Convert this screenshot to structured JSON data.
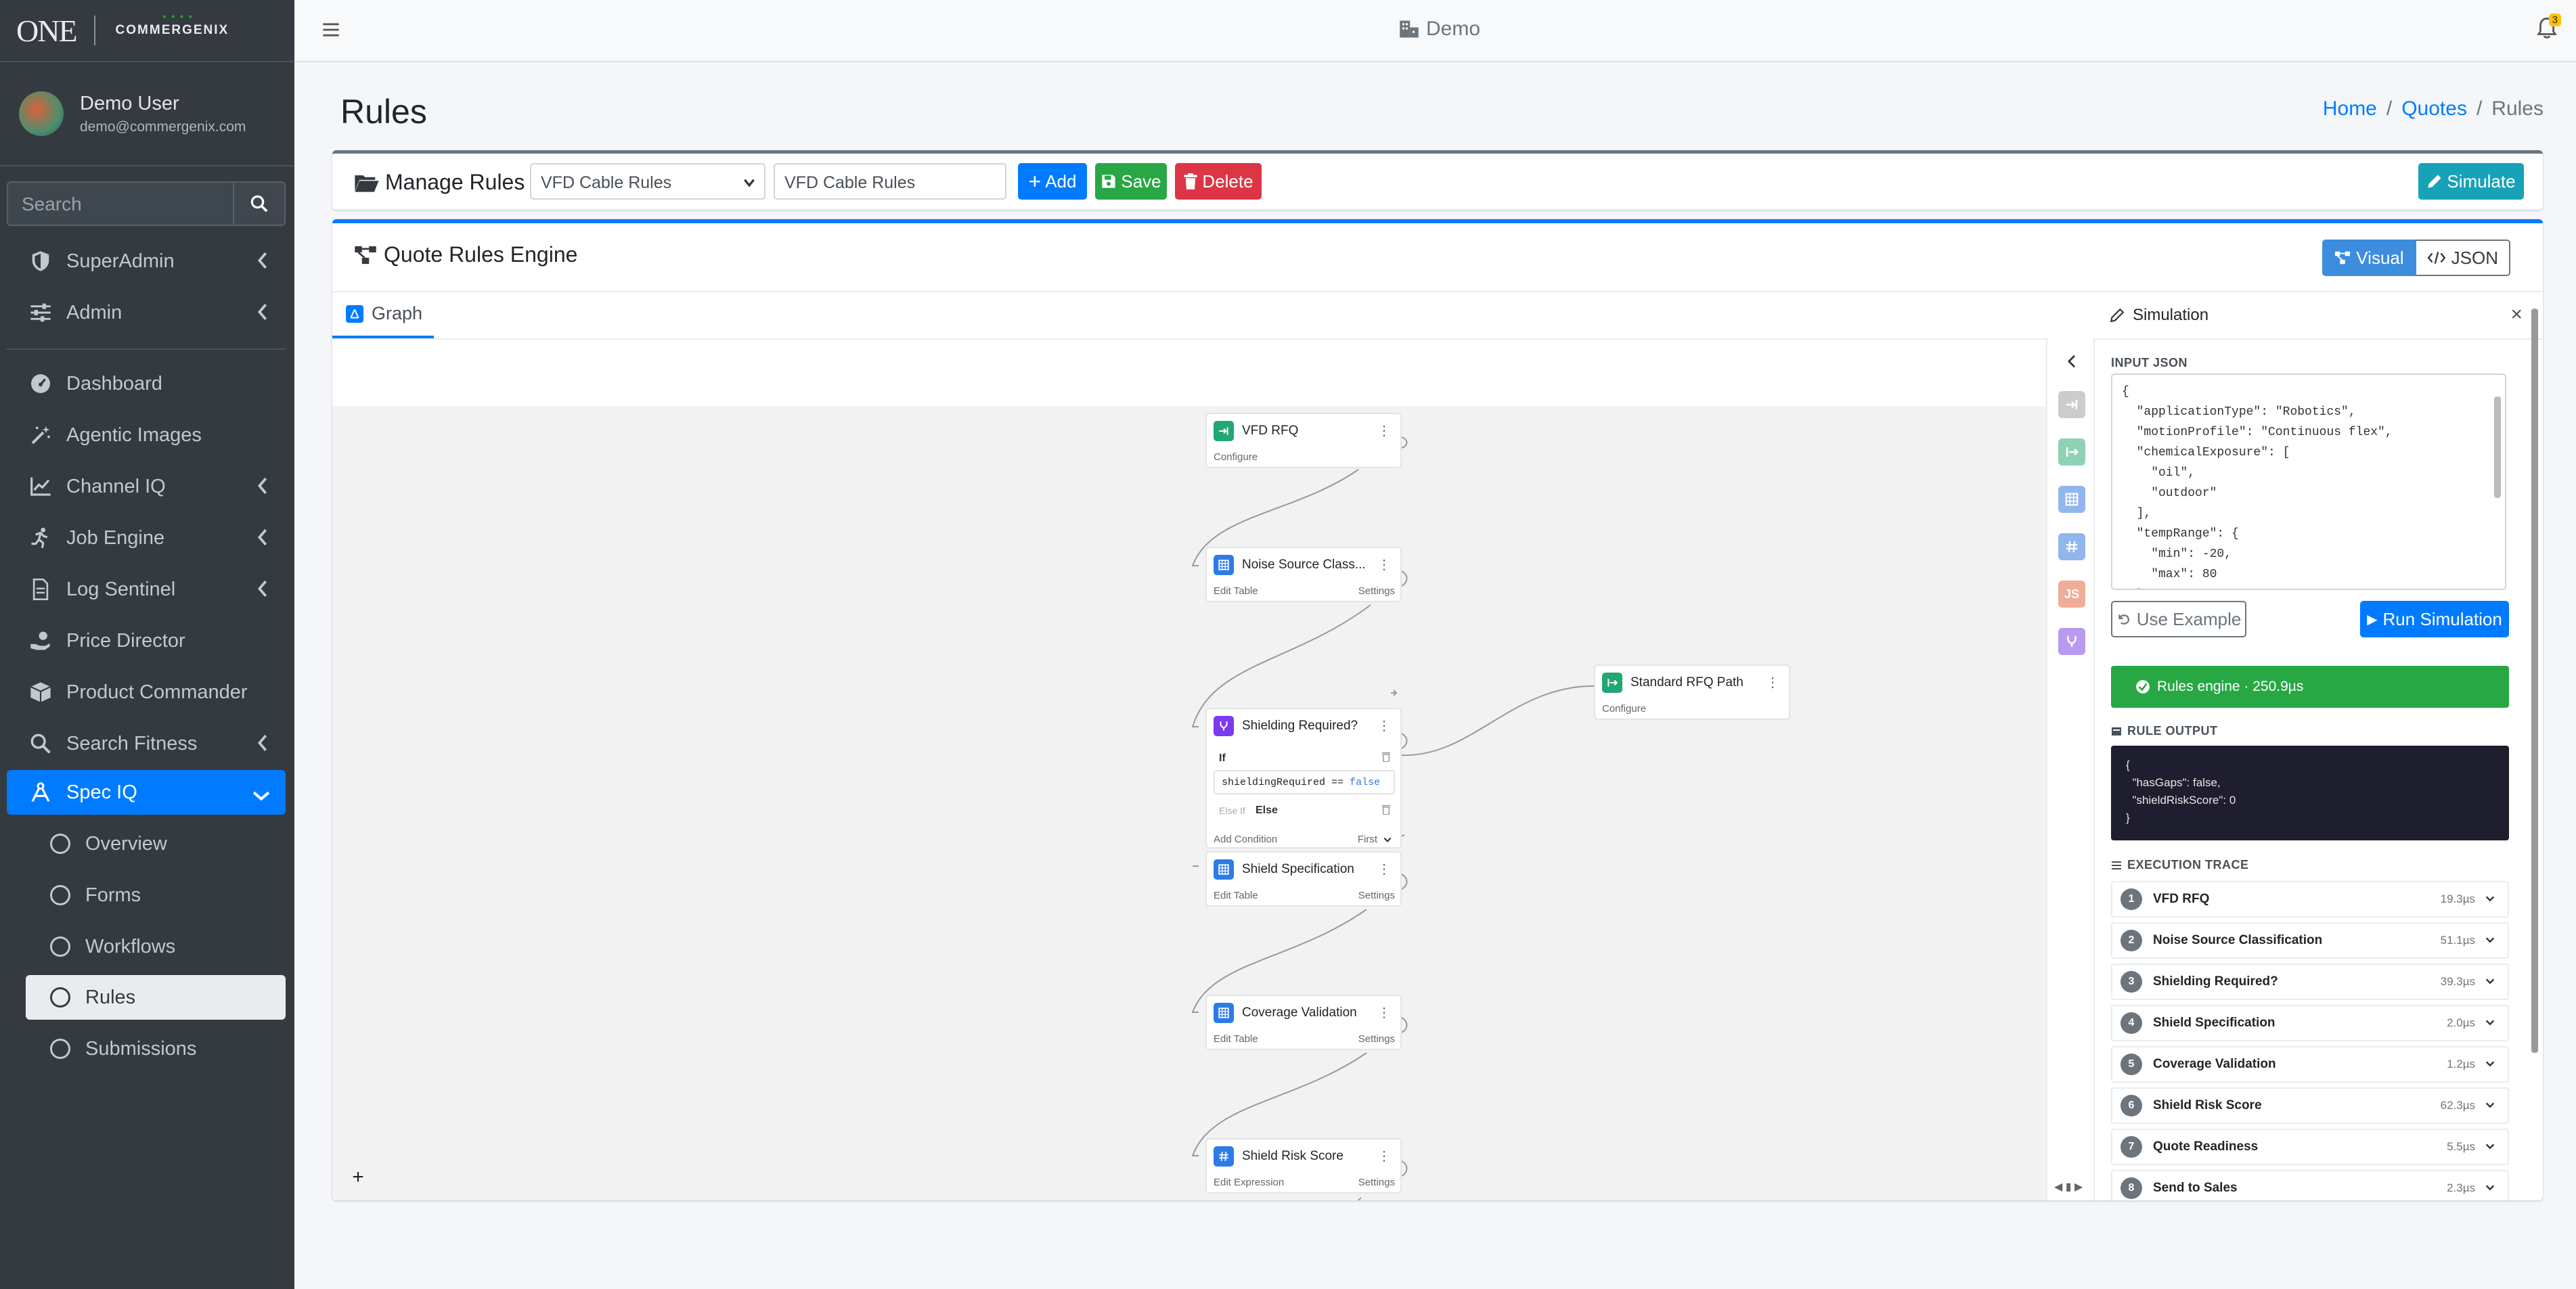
{
  "sidebar": {
    "brand_one": "ONE",
    "brand_name": "COMMERGENIX",
    "user_name": "Demo User",
    "user_email": "demo@commergenix.com",
    "search_placeholder": "Search",
    "items": [
      {
        "label": "SuperAdmin",
        "icon": "shield-icon"
      },
      {
        "label": "Admin",
        "icon": "sliders-icon"
      },
      {
        "label": "Dashboard",
        "icon": "gauge-icon"
      },
      {
        "label": "Agentic Images",
        "icon": "magic-wand-icon"
      },
      {
        "label": "Channel IQ",
        "icon": "line-chart-icon"
      },
      {
        "label": "Job Engine",
        "icon": "running-icon"
      },
      {
        "label": "Log Sentinel",
        "icon": "file-icon"
      },
      {
        "label": "Price Director",
        "icon": "hand-coin-icon"
      },
      {
        "label": "Product Commander",
        "icon": "box-icon"
      },
      {
        "label": "Search Fitness",
        "icon": "search-icon"
      },
      {
        "label": "Spec IQ",
        "icon": "spec-icon"
      }
    ],
    "sub_items": [
      "Overview",
      "Forms",
      "Workflows",
      "Rules",
      "Submissions"
    ]
  },
  "topbar": {
    "title": "Demo",
    "notification_count": "3"
  },
  "page": {
    "title": "Rules",
    "breadcrumb": [
      "Home",
      "Quotes",
      "Rules"
    ]
  },
  "manage": {
    "label": "Manage Rules",
    "selected_rule": "VFD Cable Rules",
    "rule_name_value": "VFD Cable Rules",
    "add": "Add",
    "save": "Save",
    "delete": "Delete",
    "simulate": "Simulate"
  },
  "engine": {
    "title": "Quote Rules Engine",
    "toggle_visual": "Visual",
    "toggle_json": "JSON",
    "tab_graph": "Graph"
  },
  "nodes": {
    "vfd": {
      "title": "VFD RFQ",
      "footer": "Configure"
    },
    "noise": {
      "title": "Noise Source Class...",
      "footer": "Edit Table",
      "settings": "Settings"
    },
    "shield_req": {
      "title": "Shielding Required?",
      "if_label": "If",
      "condition": "shieldingRequired",
      "operator": "==",
      "value": "false",
      "elseif_label": "Else If",
      "else_label": "Else",
      "add_condition": "Add Condition",
      "first": "First"
    },
    "std_rfq": {
      "title": "Standard RFQ Path",
      "footer": "Configure"
    },
    "shield_spec": {
      "title": "Shield Specification",
      "footer": "Edit Table",
      "settings": "Settings"
    },
    "coverage": {
      "title": "Coverage Validation",
      "footer": "Edit Table",
      "settings": "Settings"
    },
    "risk": {
      "title": "Shield Risk Score",
      "footer": "Edit Expression",
      "settings": "Settings"
    }
  },
  "simulation": {
    "title": "Simulation",
    "input_label": "INPUT JSON",
    "input_json": "{\n  \"applicationType\": \"Robotics\",\n  \"motionProfile\": \"Continuous flex\",\n  \"chemicalExposure\": [\n    \"oil\",\n    \"outdoor\"\n  ],\n  \"tempRange\": {\n    \"min\": -20,\n    \"max\": 80\n  },",
    "use_example": "Use Example",
    "run": "Run Simulation",
    "status": "Rules engine · 250.9µs",
    "output_label": "RULE OUTPUT",
    "output": "{\n  \"hasGaps\": false,\n  \"shieldRiskScore\": 0\n}",
    "trace_label": "EXECUTION TRACE",
    "trace": [
      {
        "n": "1",
        "name": "VFD RFQ",
        "time": "19.3µs"
      },
      {
        "n": "2",
        "name": "Noise Source Classification",
        "time": "51.1µs"
      },
      {
        "n": "3",
        "name": "Shielding Required?",
        "time": "39.3µs"
      },
      {
        "n": "4",
        "name": "Shield Specification",
        "time": "2.0µs"
      },
      {
        "n": "5",
        "name": "Coverage Validation",
        "time": "1.2µs"
      },
      {
        "n": "6",
        "name": "Shield Risk Score",
        "time": "62.3µs"
      },
      {
        "n": "7",
        "name": "Quote Readiness",
        "time": "5.5µs"
      },
      {
        "n": "8",
        "name": "Send to Sales",
        "time": "2.3µs"
      }
    ]
  },
  "colors": {
    "primary": "#007bff",
    "success": "#28a745",
    "danger": "#dc3545",
    "info": "#17a2b8",
    "sidebar": "#343a40"
  }
}
